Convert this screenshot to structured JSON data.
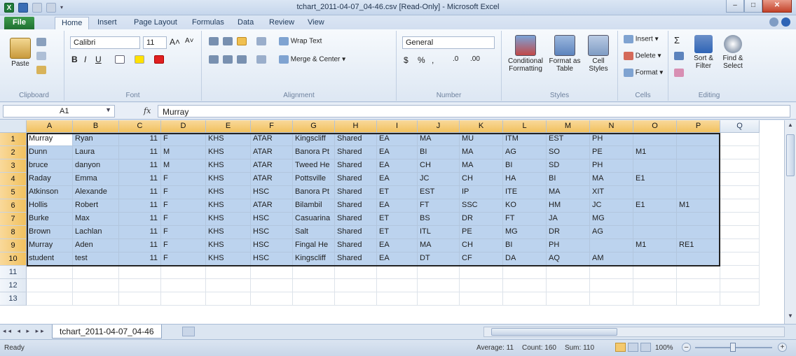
{
  "window": {
    "title": "tchart_2011-04-07_04-46.csv  [Read-Only]  -  Microsoft Excel",
    "app_icon_label": "X",
    "minimize": "–",
    "maximize": "□",
    "close": "✕"
  },
  "ribbon_tabs": [
    "File",
    "Home",
    "Insert",
    "Page Layout",
    "Formulas",
    "Data",
    "Review",
    "View"
  ],
  "ribbon": {
    "clipboard": {
      "paste": "Paste",
      "label": "Clipboard"
    },
    "font": {
      "name": "Calibri",
      "size": "11",
      "grow": "A˄",
      "shrink": "A˅",
      "bold": "B",
      "italic": "I",
      "underline": "U",
      "label": "Font"
    },
    "alignment": {
      "wrap": "Wrap Text",
      "merge": "Merge & Center",
      "label": "Alignment"
    },
    "number": {
      "format": "General",
      "currency": "$",
      "percent": "%",
      "comma": ",",
      "inc_dec": ".0",
      "dec_dec": ".00",
      "label": "Number"
    },
    "styles": {
      "conditional": "Conditional Formatting",
      "format_table": "Format as Table",
      "cell_styles": "Cell Styles",
      "label": "Styles"
    },
    "cells": {
      "insert": "Insert",
      "delete": "Delete",
      "format": "Format",
      "label": "Cells"
    },
    "editing": {
      "sum": "Σ",
      "sort": "Sort & Filter",
      "find": "Find & Select",
      "label": "Editing"
    }
  },
  "formula_bar": {
    "name_box": "A1",
    "fx": "fx",
    "content": "Murray"
  },
  "columns": [
    "A",
    "B",
    "C",
    "D",
    "E",
    "F",
    "G",
    "H",
    "I",
    "J",
    "K",
    "L",
    "M",
    "N",
    "O",
    "P",
    "Q"
  ],
  "rows": [
    [
      "Murray",
      "Ryan",
      "11",
      "F",
      "KHS",
      "ATAR",
      "Kingscliff",
      "Shared",
      "EA",
      "MA",
      "MU",
      "ITM",
      "EST",
      "PH",
      "",
      ""
    ],
    [
      "Dunn",
      "Laura",
      "11",
      "M",
      "KHS",
      "ATAR",
      "Banora Pt",
      "Shared",
      "EA",
      "BI",
      "MA",
      "AG",
      "SO",
      "PE",
      "M1",
      ""
    ],
    [
      "bruce",
      "danyon",
      "11",
      "M",
      "KHS",
      "ATAR",
      "Tweed He",
      "Shared",
      "EA",
      "CH",
      "MA",
      "BI",
      "SD",
      "PH",
      "",
      ""
    ],
    [
      "Raday",
      "Emma",
      "11",
      "F",
      "KHS",
      "ATAR",
      "Pottsville",
      "Shared",
      "EA",
      "JC",
      "CH",
      "HA",
      "BI",
      "MA",
      "E1",
      ""
    ],
    [
      "Atkinson",
      "Alexande",
      "11",
      "F",
      "KHS",
      "HSC",
      "Banora Pt",
      "Shared",
      "ET",
      "EST",
      "IP",
      "ITE",
      "MA",
      "XIT",
      "",
      ""
    ],
    [
      "Hollis",
      "Robert",
      "11",
      "F",
      "KHS",
      "ATAR",
      "Bilambil",
      "Shared",
      "EA",
      "FT",
      "SSC",
      "KO",
      "HM",
      "JC",
      "E1",
      "M1"
    ],
    [
      "Burke",
      "Max",
      "11",
      "F",
      "KHS",
      "HSC",
      "Casuarina",
      "Shared",
      "ET",
      "BS",
      "DR",
      "FT",
      "JA",
      "MG",
      "",
      ""
    ],
    [
      "Brown",
      "Lachlan",
      "11",
      "F",
      "KHS",
      "HSC",
      "Salt",
      "Shared",
      "ET",
      "ITL",
      "PE",
      "MG",
      "DR",
      "AG",
      "",
      ""
    ],
    [
      "Murray",
      "Aden",
      "11",
      "F",
      "KHS",
      "HSC",
      "Fingal He",
      "Shared",
      "EA",
      "MA",
      "CH",
      "BI",
      "PH",
      "",
      "M1",
      "RE1"
    ],
    [
      "student",
      "test",
      "11",
      "F",
      "KHS",
      "HSC",
      "Kingscliff",
      "Shared",
      "EA",
      "DT",
      "CF",
      "DA",
      "AQ",
      "AM",
      "",
      ""
    ]
  ],
  "row_numbers": [
    "1",
    "2",
    "3",
    "4",
    "5",
    "6",
    "7",
    "8",
    "9",
    "10",
    "11",
    "12",
    "13"
  ],
  "sheet_tab": "tchart_2011-04-07_04-46",
  "status": {
    "ready": "Ready",
    "average": "Average: 11",
    "count": "Count: 160",
    "sum": "Sum: 110",
    "zoom": "100%",
    "zoom_out": "–",
    "zoom_in": "+"
  },
  "colors": {
    "selection": "#bcd3ee",
    "header_selected": "#f1c15e",
    "file_tab": "#1f7031"
  }
}
